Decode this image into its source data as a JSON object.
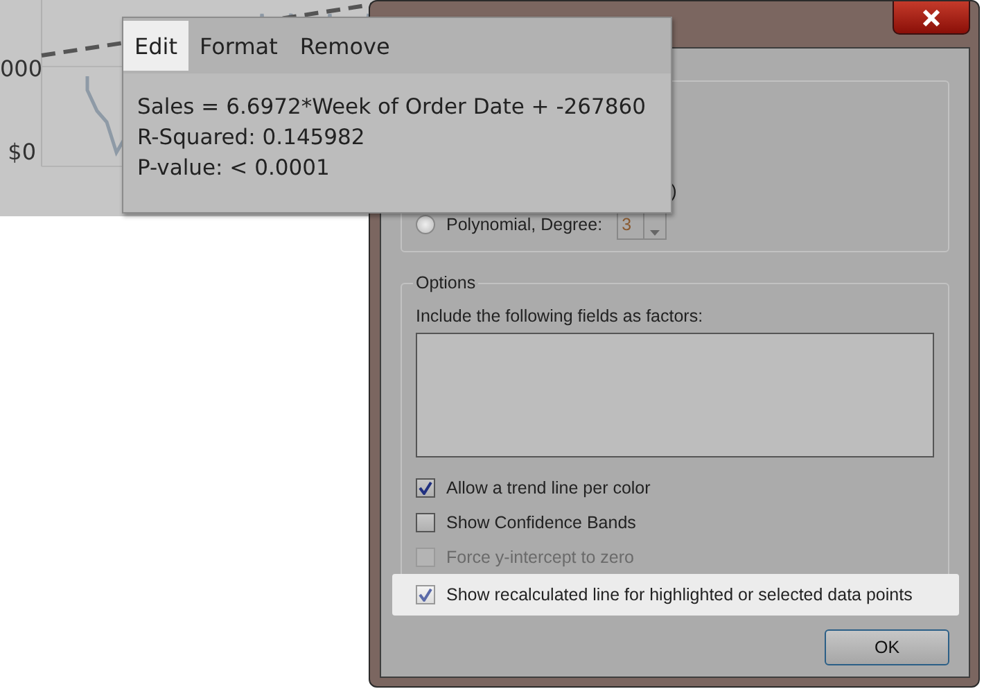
{
  "chart": {
    "y_axis_labels": [
      "000",
      "$0"
    ]
  },
  "dialog": {
    "regression_group": {
      "partial_label": ")",
      "degree_option": {
        "label": "Polynomial, Degree:",
        "selected": false,
        "degree": "3"
      }
    },
    "options": {
      "title": "Options",
      "factors_label": "Include the following fields as factors:",
      "checkboxes": [
        {
          "label": "Allow a trend line per color",
          "checked": true,
          "disabled": false,
          "highlighted": false
        },
        {
          "label": "Show Confidence Bands",
          "checked": false,
          "disabled": false,
          "highlighted": false
        },
        {
          "label": "Force y-intercept to zero",
          "checked": false,
          "disabled": true,
          "highlighted": false
        },
        {
          "label": "Show recalculated line for highlighted or selected data points",
          "checked": true,
          "disabled": false,
          "highlighted": true
        }
      ]
    },
    "ok_button": "OK"
  },
  "popup": {
    "menu": [
      {
        "label": "Edit",
        "selected": true
      },
      {
        "label": "Format",
        "selected": false
      },
      {
        "label": "Remove",
        "selected": false
      }
    ],
    "lines": [
      "Sales = 6.6972*Week of Order Date + -267860",
      "R-Squared: 0.145982",
      "P-value: < 0.0001"
    ]
  }
}
